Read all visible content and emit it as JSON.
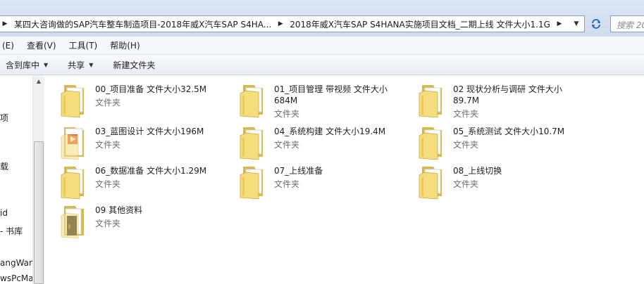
{
  "address": {
    "crumbs": [
      "某四大咨询做的SAP汽车整车制造项目-2018年威X汽车SAP S4HA...",
      "2018年威X汽车SAP S4HANA实施项目文档_二期上线 文件大小1.1G"
    ]
  },
  "search": {
    "placeholder": "搜索 20"
  },
  "menu": {
    "items": [
      "(E)",
      "查看(V)",
      "工具(T)",
      "帮助(H)"
    ]
  },
  "toolbar": {
    "include_library": "含到库中",
    "share": "共享",
    "new_folder": "新建文件夹"
  },
  "nav": {
    "items": [
      "项",
      "载",
      "id",
      "- 书库",
      "angWan",
      "wsPcMa"
    ]
  },
  "folders": [
    {
      "name": "00_项目准备 文件大小32.5M",
      "kind": "文件夹",
      "icon": "folder-icon"
    },
    {
      "name": "01_项目管理 带视频 文件大小684M",
      "kind": "文件夹",
      "icon": "folder-icon"
    },
    {
      "name": "02 现状分析与调研 文件大小89.7M",
      "kind": "文件夹",
      "icon": "folder-icon"
    },
    {
      "name": "03_蓝图设计 文件大小196M",
      "kind": "文件夹",
      "icon": "folder-document-icon"
    },
    {
      "name": "04_系统构建 文件大小19.4M",
      "kind": "文件夹",
      "icon": "folder-icon"
    },
    {
      "name": "05_系统测试 文件大小10.7M",
      "kind": "文件夹",
      "icon": "folder-icon"
    },
    {
      "name": "06_数据准备 文件大小1.29M",
      "kind": "文件夹",
      "icon": "folder-icon"
    },
    {
      "name": "07_上线准备",
      "kind": "文件夹",
      "icon": "folder-icon"
    },
    {
      "name": "08_上线切换",
      "kind": "文件夹",
      "icon": "folder-icon"
    },
    {
      "name": "09 其他资料",
      "kind": "文件夹",
      "icon": "folder-black-doc-icon"
    }
  ]
}
